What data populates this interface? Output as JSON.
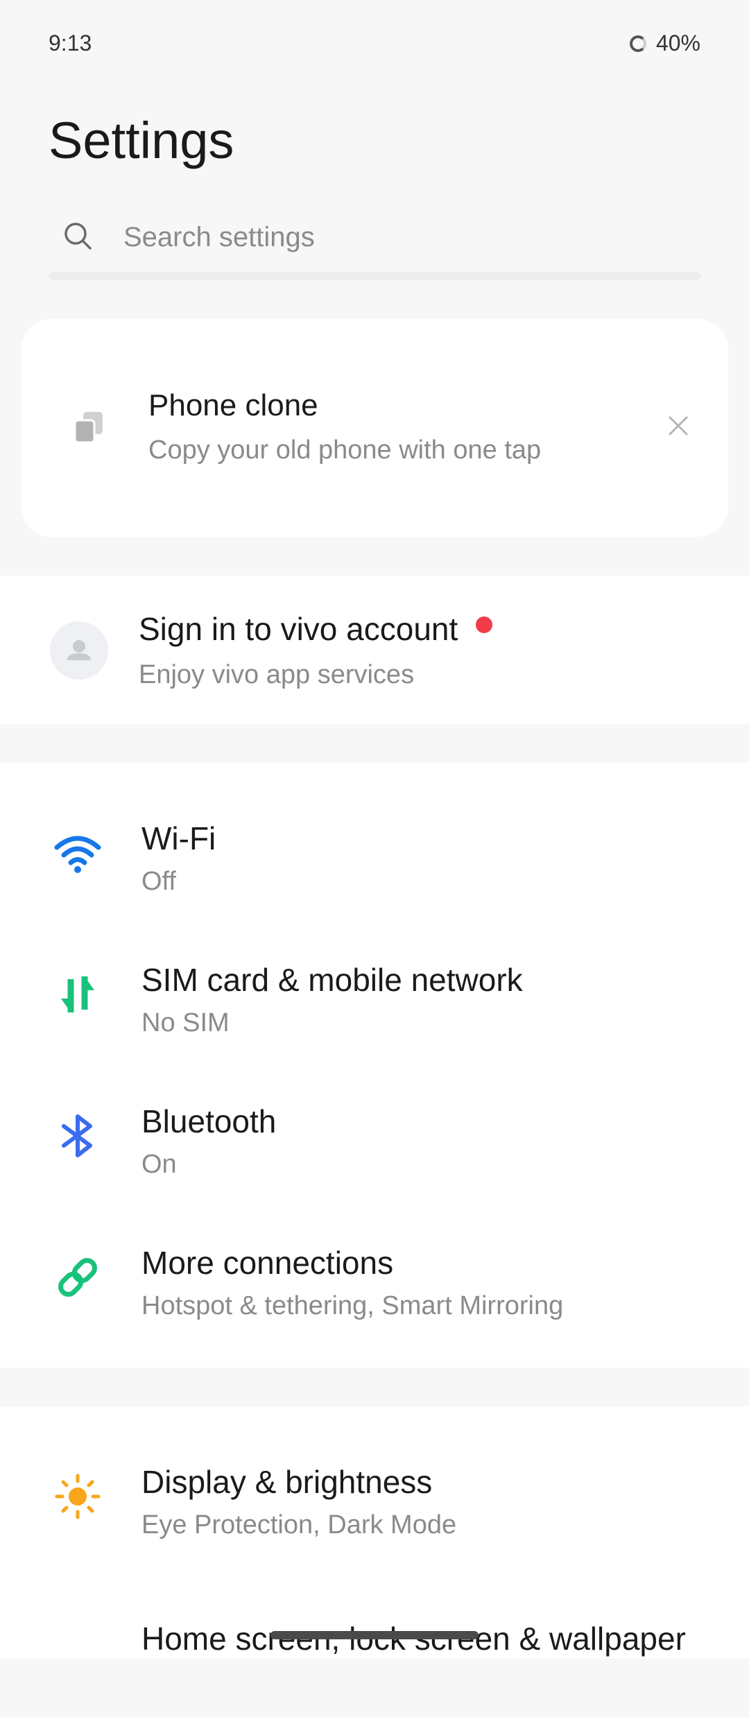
{
  "status": {
    "time": "9:13",
    "battery": "40%"
  },
  "header": {
    "title": "Settings"
  },
  "search": {
    "placeholder": "Search settings"
  },
  "phone_clone": {
    "title": "Phone clone",
    "subtitle": "Copy your old phone with one tap"
  },
  "account": {
    "title": "Sign in to vivo account",
    "subtitle": "Enjoy vivo app services"
  },
  "connections": [
    {
      "title": "Wi-Fi",
      "subtitle": "Off",
      "icon": "wifi-icon",
      "color": "#1677e8"
    },
    {
      "title": "SIM card & mobile network",
      "subtitle": "No SIM",
      "icon": "mobile-data-icon",
      "color": "#19c27a"
    },
    {
      "title": "Bluetooth",
      "subtitle": "On",
      "icon": "bluetooth-icon",
      "color": "#3b6cf0"
    },
    {
      "title": "More connections",
      "subtitle": "Hotspot & tethering, Smart Mirroring",
      "icon": "link-icon",
      "color": "#19c27a"
    }
  ],
  "display": [
    {
      "title": "Display & brightness",
      "subtitle": "Eye Protection, Dark Mode",
      "icon": "sun-icon",
      "color": "#f7a51b"
    },
    {
      "title": "Home screen, lock screen & wallpaper",
      "icon": "home-screen-icon"
    }
  ]
}
